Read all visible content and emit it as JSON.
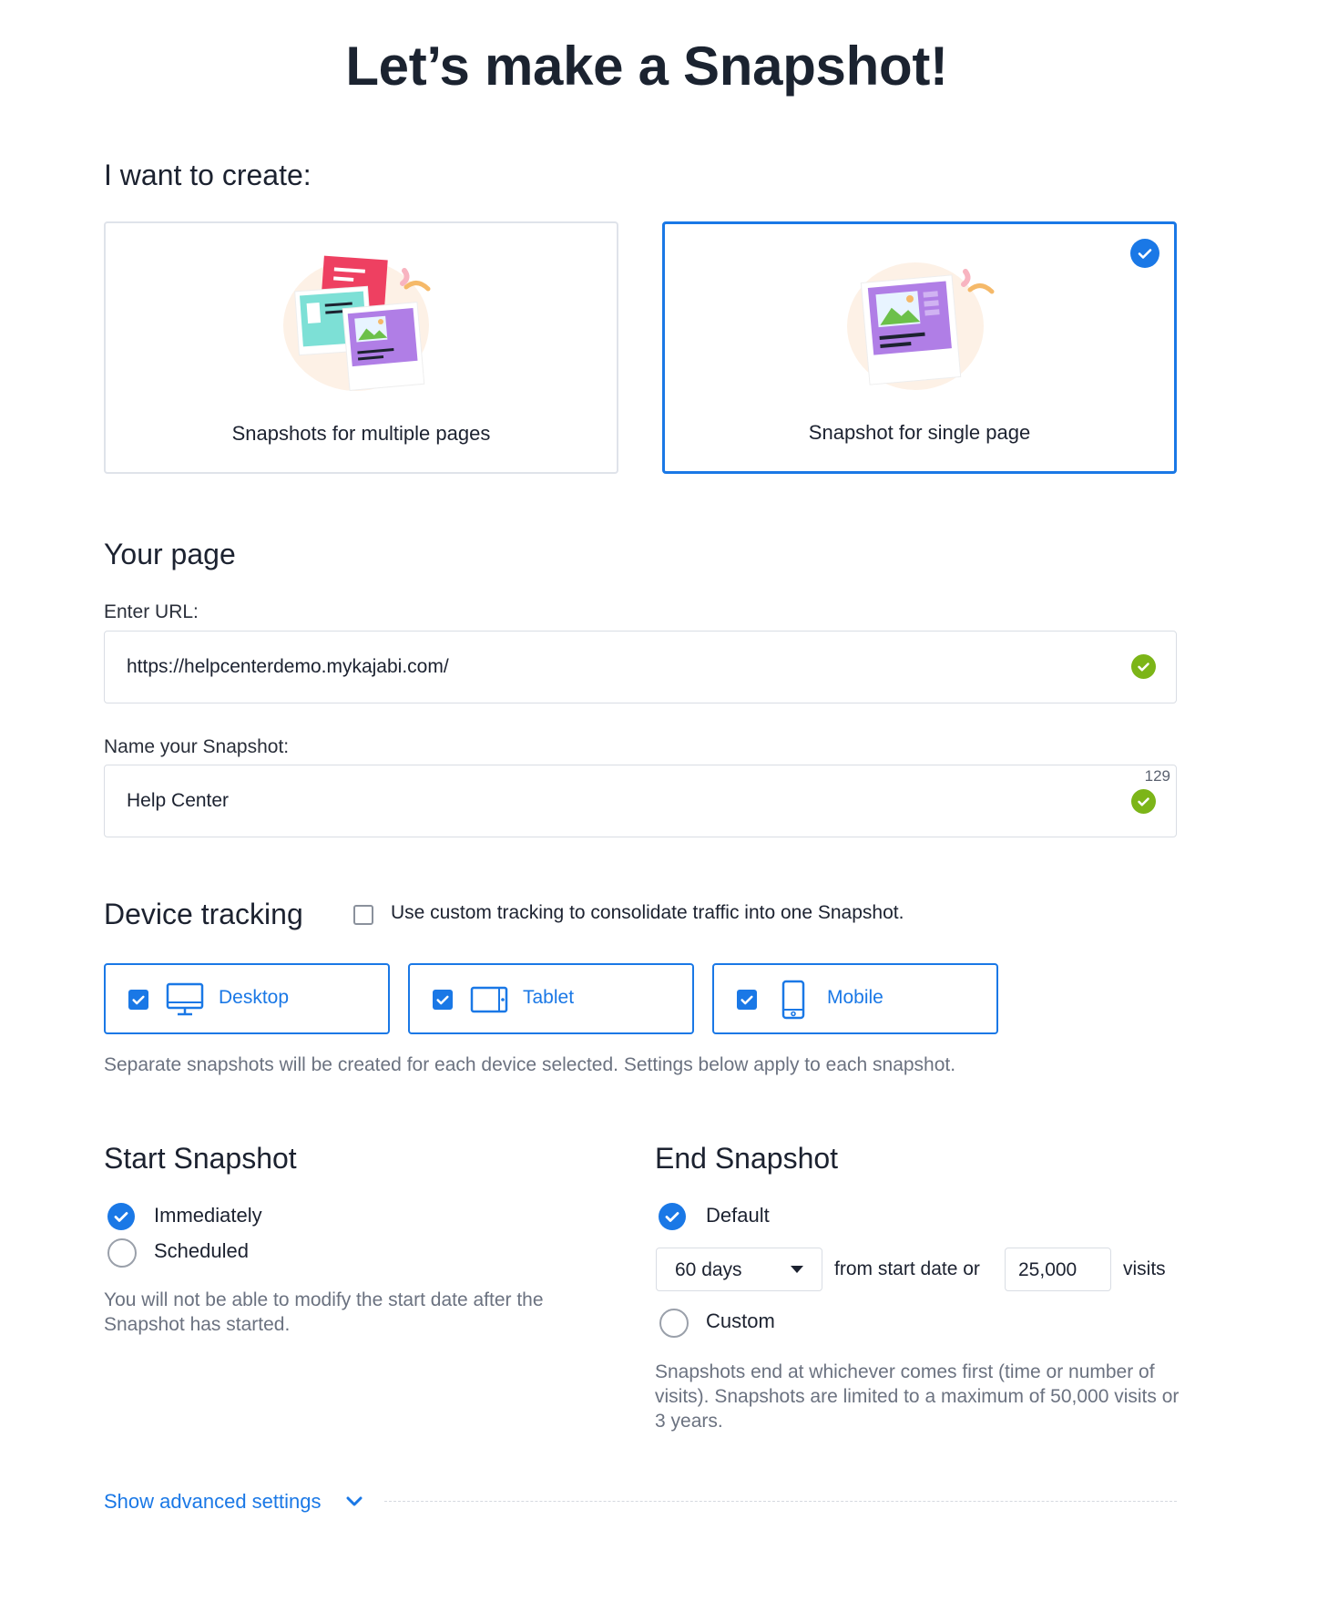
{
  "page": {
    "title": "Let’s make a Snapshot!"
  },
  "create": {
    "heading": "I want to create:",
    "options": [
      {
        "label": "Snapshots for multiple pages",
        "selected": false
      },
      {
        "label": "Snapshot for single page",
        "selected": true
      }
    ]
  },
  "your_page": {
    "heading": "Your page",
    "url_label": "Enter URL:",
    "url_value": "https://helpcenterdemo.mykajabi.com/",
    "name_label": "Name your Snapshot:",
    "name_value": "Help Center",
    "name_counter": "129"
  },
  "device_tracking": {
    "heading": "Device tracking",
    "custom_label": "Use custom tracking to consolidate traffic into one Snapshot.",
    "custom_checked": false,
    "devices": [
      {
        "label": "Desktop",
        "icon": "desktop-icon",
        "checked": true
      },
      {
        "label": "Tablet",
        "icon": "tablet-icon",
        "checked": true
      },
      {
        "label": "Mobile",
        "icon": "mobile-icon",
        "checked": true
      }
    ],
    "helper": "Separate snapshots will be created for each device selected. Settings below apply to each snapshot."
  },
  "start": {
    "heading": "Start Snapshot",
    "options": [
      {
        "label": "Immediately",
        "selected": true
      },
      {
        "label": "Scheduled",
        "selected": false
      }
    ],
    "helper": "You will not be able to modify the start date after the Snapshot has started."
  },
  "end": {
    "heading": "End Snapshot",
    "default_label": "Default",
    "default_selected": true,
    "duration_value": "60 days",
    "from_text": "from start date or",
    "visits_value": "25,000",
    "visits_text": "visits",
    "custom_label": "Custom",
    "custom_selected": false,
    "helper": "Snapshots end at whichever comes first (time or number of visits). Snapshots are limited to a maximum of 50,000 visits or 3 years."
  },
  "advanced": {
    "label": "Show advanced settings"
  },
  "colors": {
    "accent": "#1a78e6",
    "success": "#7cb518",
    "border": "#dfe3ea",
    "muted_text": "#6b7280"
  }
}
